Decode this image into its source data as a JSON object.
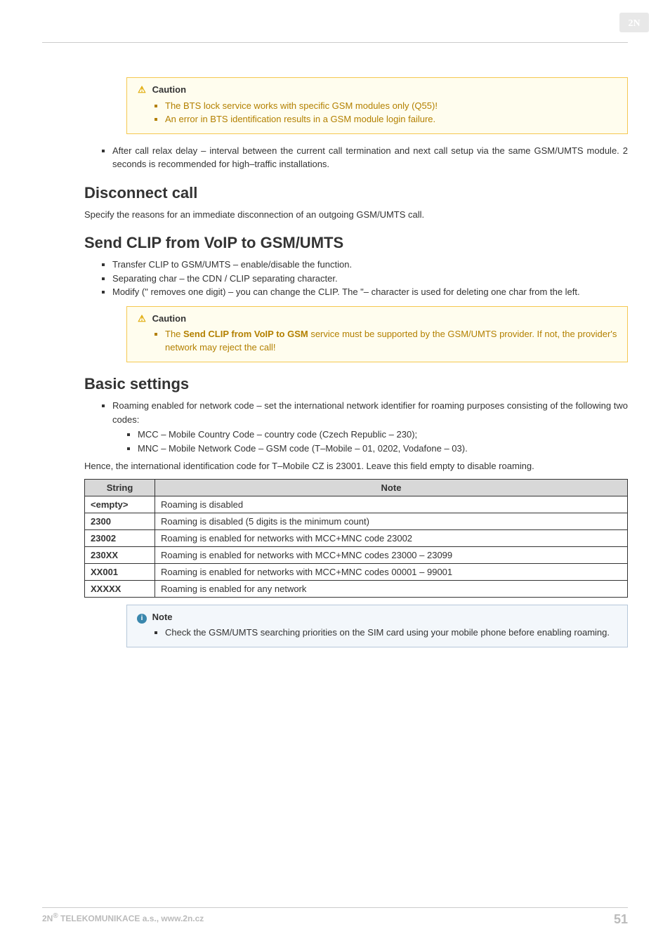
{
  "logo_text": "2N",
  "caution1": {
    "title": "Caution",
    "items": [
      "The BTS lock service works with specific GSM modules only (Q55)!",
      "An error in BTS identification results in a GSM module login failure."
    ]
  },
  "after_call_item": "After call relax delay – interval between the current call termination and next call setup via the same GSM/UMTS module. 2 seconds is recommended for high–traffic installations.",
  "h_disconnect": "Disconnect call",
  "p_disconnect": "Specify the reasons for an immediate disconnection of an outgoing GSM/UMTS call.",
  "h_sendclip": "Send CLIP from VoIP to GSM/UMTS",
  "sendclip_items": [
    "Transfer CLIP to GSM/UMTS – enable/disable the function.",
    "Separating char – the CDN / CLIP separating character.",
    "Modify (\" removes one digit) – you can change the CLIP. The \"– character is used for deleting one char from the left."
  ],
  "caution2": {
    "title": "Caution",
    "prefix": "The ",
    "bold": "Send CLIP from VoIP to GSM",
    "suffix": " service must be supported by the GSM/UMTS provider. If not, the provider's network may reject the call!"
  },
  "h_basic": "Basic settings",
  "roaming_intro": "Roaming enabled for network code – set the international network identifier for roaming purposes consisting of the following two codes:",
  "roaming_sub": [
    "MCC – Mobile Country Code – country code (Czech Republic – 230);",
    "MNC – Mobile Network Code – GSM code (T–Mobile – 01, 0202, Vodafone – 03)."
  ],
  "p_hence": "Hence, the international identification code for T–Mobile CZ is 23001. Leave this field empty to disable roaming.",
  "table": {
    "head": {
      "c1": "String",
      "c2": "Note"
    },
    "rows": [
      {
        "k": "<empty>",
        "v": "Roaming is disabled"
      },
      {
        "k": "2300",
        "v": "Roaming is disabled (5 digits is the minimum count)"
      },
      {
        "k": "23002",
        "v": "Roaming is enabled for networks with MCC+MNC code 23002"
      },
      {
        "k": "230XX",
        "v": "Roaming is enabled for networks with MCC+MNC codes 23000 – 23099"
      },
      {
        "k": "XX001",
        "v": "Roaming is enabled for networks with MCC+MNC codes 00001 – 99001"
      },
      {
        "k": "XXXXX",
        "v": "Roaming is enabled for any network"
      }
    ]
  },
  "note1": {
    "title": "Note",
    "items": [
      "Check the GSM/UMTS searching priorities on the SIM card using your mobile phone before enabling roaming."
    ]
  },
  "footer": {
    "left_prefix": "2N",
    "left_sup": "®",
    "left_rest": " TELEKOMUNIKACE a.s., www.2n.cz",
    "page": "51"
  }
}
